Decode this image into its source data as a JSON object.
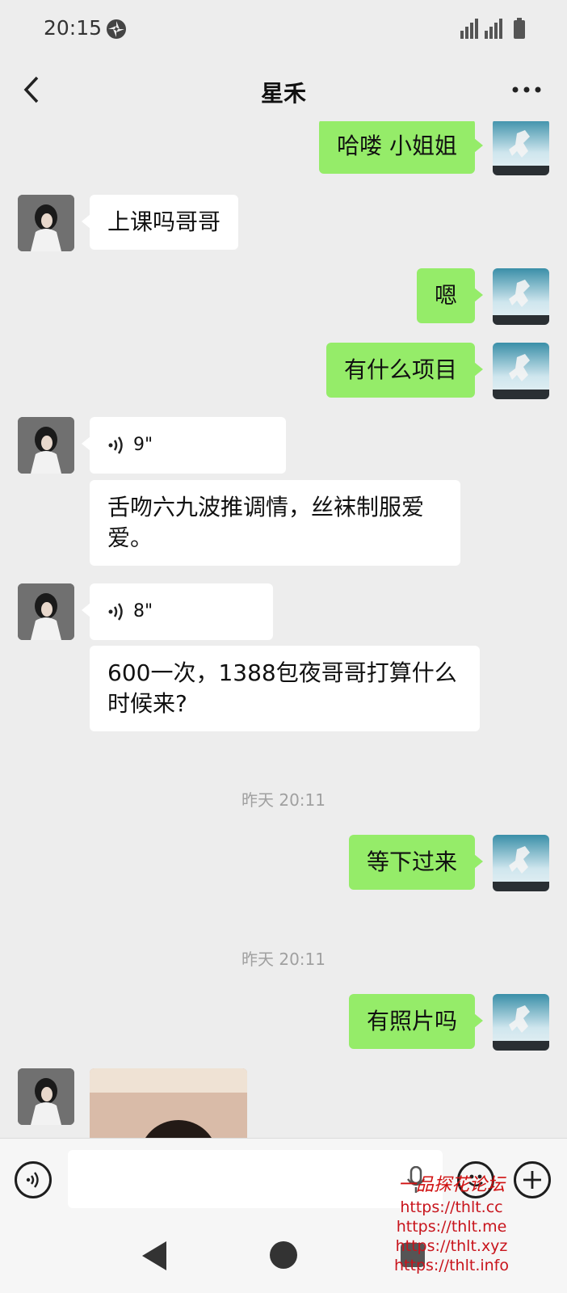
{
  "status_bar": {
    "time": "20:15"
  },
  "header": {
    "title": "星禾"
  },
  "messages": {
    "m1": "哈喽 小姐姐",
    "m2": "上课吗哥哥",
    "m3": "嗯",
    "m4": "有什么项目",
    "m5_voice": "9\"",
    "m6": "舌吻六九波推调情，丝袜制服爱爱。",
    "m7_voice": "8\"",
    "m8": "600一次，1388包夜哥哥打算什么时候来?",
    "ts1": "昨天 20:11",
    "m9": "等下过来",
    "ts2": "昨天 20:11",
    "m10": "有照片吗"
  },
  "input": {
    "value": "",
    "placeholder": ""
  },
  "watermark": {
    "title": "一品探花论坛",
    "urls": [
      "https://thlt.cc",
      "https://thlt.me",
      "https://thlt.xyz",
      "https://thlt.info"
    ]
  },
  "colors": {
    "self_bubble": "#95ec69",
    "other_bubble": "#ffffff",
    "background": "#ededed",
    "watermark": "#c8141c"
  },
  "icons": {
    "back": "chevron-left-icon",
    "more": "more-dots-icon",
    "voice_input": "voice-circle-icon",
    "emoji": "emoji-icon",
    "plus": "plus-circle-icon"
  }
}
